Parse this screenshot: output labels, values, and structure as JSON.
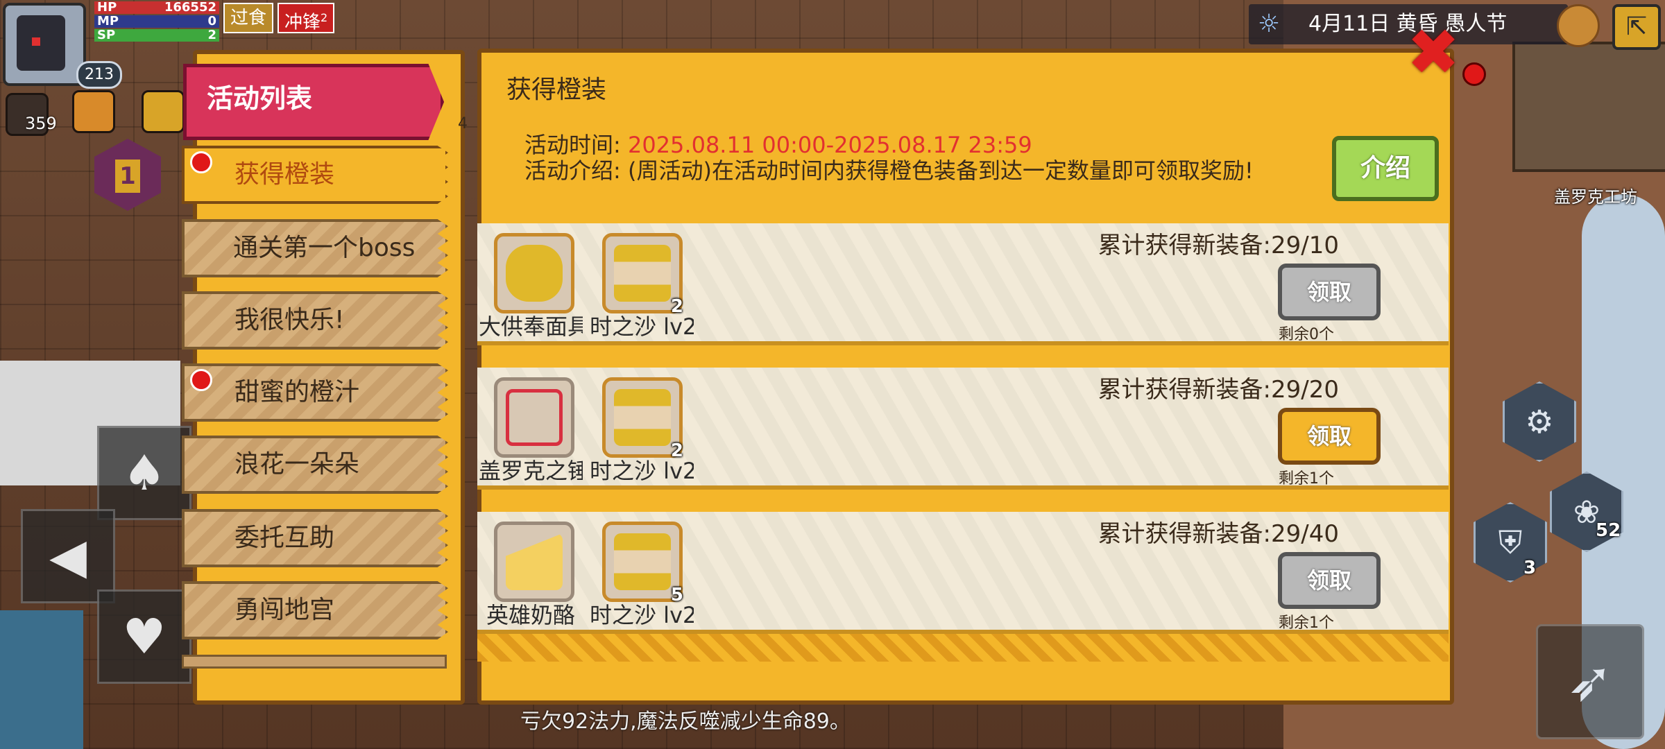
{
  "hud": {
    "hp_label": "HP",
    "hp_value": "166552",
    "mp_label": "MP",
    "mp_value": "0",
    "sp_label": "SP",
    "sp_value": "2",
    "level": "213",
    "tag_overeat": "过食",
    "tag_charge": "冲锋",
    "tag_charge_sup": "2",
    "resource_count": "359",
    "floor_number": "1"
  },
  "top_right": {
    "date_text": "4月11日 黄昏 愚人节",
    "npc_label": "盖罗克工坊"
  },
  "skills": {
    "paw_count": "52",
    "armor_count": "3"
  },
  "menu": {
    "header": "活动列表",
    "side_count": "4",
    "items": [
      {
        "label": "获得橙装"
      },
      {
        "label": "通关第一个boss"
      },
      {
        "label": "我很快乐!"
      },
      {
        "label": "甜蜜的橙汁"
      },
      {
        "label": "浪花一朵朵"
      },
      {
        "label": "委托互助"
      },
      {
        "label": "勇闯地宫"
      }
    ]
  },
  "activity": {
    "title": "获得橙装",
    "time_label": "活动时间:",
    "time_value": "2025.08.11 00:00-2025.08.17 23:59",
    "desc_label": "活动介绍:",
    "desc_value": "(周活动)在活动时间内获得橙色装备到达一定数量即可领取奖励!",
    "intro_button": "介绍"
  },
  "rewards": [
    {
      "item1_name": "大供奉面具",
      "item2_name": "时之沙 lv2",
      "item2_count": "2",
      "progress": "累计获得新装备:29/10",
      "button": "领取",
      "remain": "剩余0个"
    },
    {
      "item1_name": "盖罗克之锤",
      "item2_name": "时之沙 lv2",
      "item2_count": "2",
      "progress": "累计获得新装备:29/20",
      "button": "领取",
      "remain": "剩余1个"
    },
    {
      "item1_name": "英雄奶酪",
      "item2_name": "时之沙 lv2",
      "item2_count": "5",
      "progress": "累计获得新装备:29/40",
      "button": "领取",
      "remain": "剩余1个"
    }
  ],
  "log": {
    "line": "亏欠92法力,魔法反噬减少生命89。"
  }
}
